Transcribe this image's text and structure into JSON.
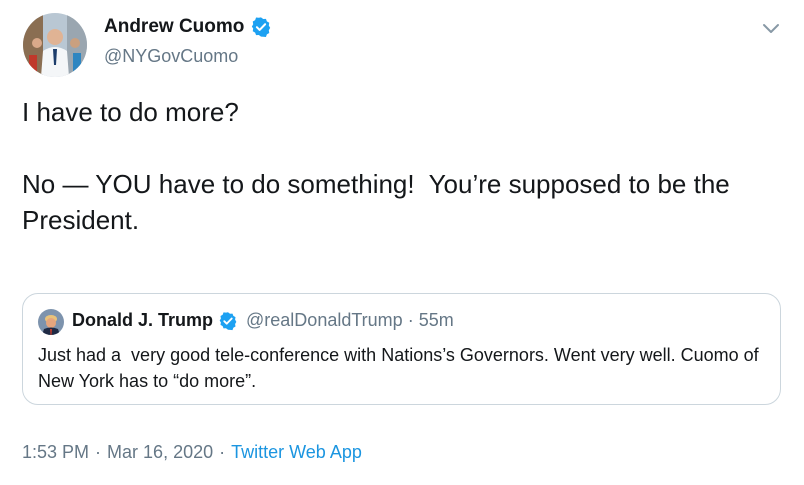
{
  "author": {
    "name": "Andrew Cuomo",
    "handle": "@NYGovCuomo"
  },
  "tweet_text": "I have to do more?\n\nNo — YOU have to do something!  You’re supposed to be the President.",
  "quoted": {
    "name": "Donald J. Trump",
    "handle": "@realDonaldTrump",
    "separator": "·",
    "time": "55m",
    "text": "Just had a  very good tele-conference with Nations’s Governors. Went very well. Cuomo of New York has to “do more”."
  },
  "meta": {
    "time": "1:53 PM",
    "dot1": "·",
    "date": "Mar 16, 2020",
    "dot2": "·",
    "app": "Twitter Web App"
  },
  "colors": {
    "verified": "#1da1f2",
    "link": "#1b95e0",
    "secondary": "#657786",
    "border": "#ccd6dd"
  },
  "icons": {
    "verified": "verified-badge-icon",
    "caret": "chevron-down-icon"
  }
}
